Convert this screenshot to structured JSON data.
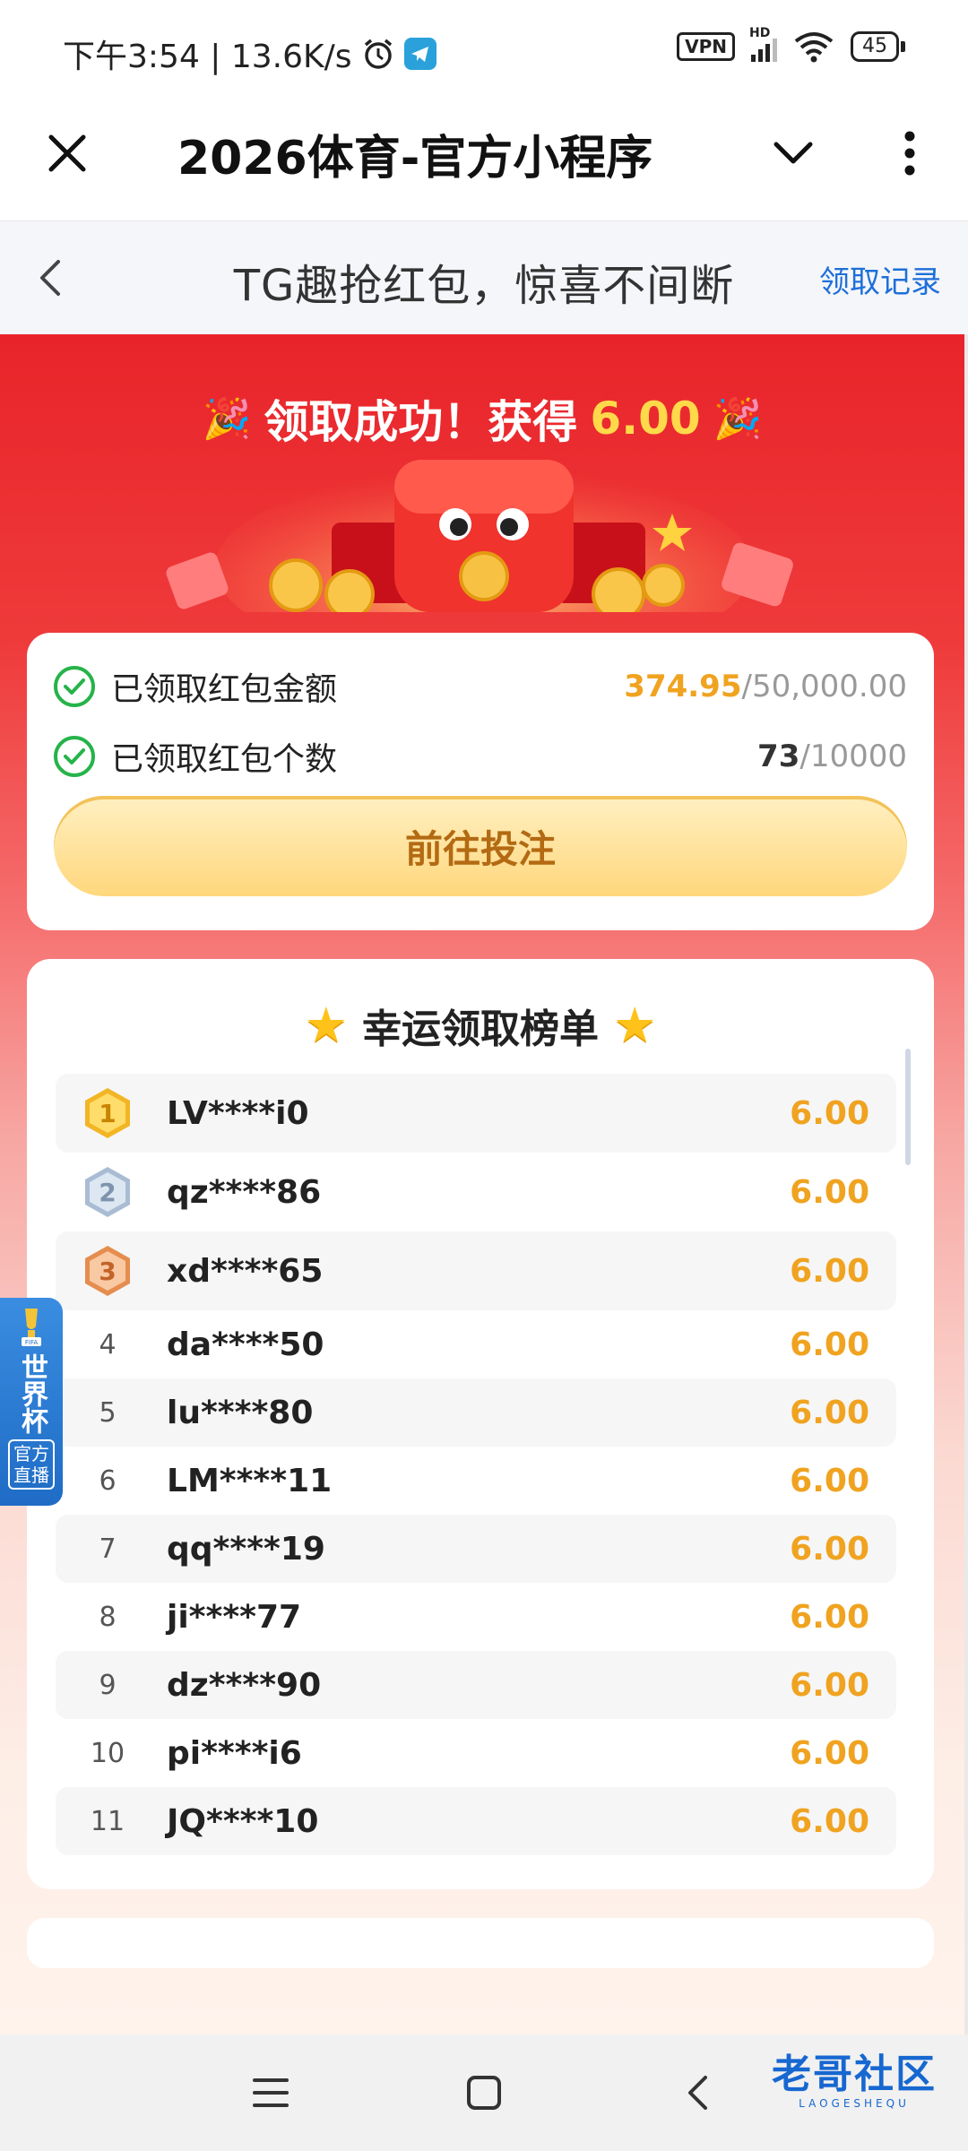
{
  "status_bar": {
    "time_speed": "下午3:54 | 13.6K/s",
    "vpn": "VPN",
    "hd": "HD",
    "battery": "45"
  },
  "app_header": {
    "title": "2026体育-官方小程序"
  },
  "sub_header": {
    "title": "TG趣抢红包，惊喜不间断",
    "record_link": "领取记录"
  },
  "banner": {
    "prefix": "领取成功！获得",
    "amount": "6.00"
  },
  "stats": {
    "amount_label": "已领取红包金额",
    "amount_current": "374.95",
    "amount_total": "/50,000.00",
    "count_label": "已领取红包个数",
    "count_current": "73",
    "count_total": "/10000",
    "button": "前往投注"
  },
  "leaderboard": {
    "title": "幸运领取榜单",
    "rows": [
      {
        "rank": "1",
        "name": "LV****i0",
        "amount": "6.00"
      },
      {
        "rank": "2",
        "name": "qz****86",
        "amount": "6.00"
      },
      {
        "rank": "3",
        "name": "xd****65",
        "amount": "6.00"
      },
      {
        "rank": "4",
        "name": "da****50",
        "amount": "6.00"
      },
      {
        "rank": "5",
        "name": "lu****80",
        "amount": "6.00"
      },
      {
        "rank": "6",
        "name": "LM****11",
        "amount": "6.00"
      },
      {
        "rank": "7",
        "name": "qq****19",
        "amount": "6.00"
      },
      {
        "rank": "8",
        "name": "ji****77",
        "amount": "6.00"
      },
      {
        "rank": "9",
        "name": "dz****90",
        "amount": "6.00"
      },
      {
        "rank": "10",
        "name": "pi****i6",
        "amount": "6.00"
      },
      {
        "rank": "11",
        "name": "JQ****10",
        "amount": "6.00"
      }
    ]
  },
  "worldcup_badge": {
    "fifa": "FIFA",
    "title": "世界杯",
    "sub": "官方直播"
  },
  "watermark": {
    "main": "老哥社区",
    "sub": "LAOGESHEQU"
  },
  "colors": {
    "brand_red": "#e8242a",
    "amount_orange": "#f0a320",
    "link_blue": "#1e6fd9",
    "check_green": "#26b34a"
  },
  "icons": [
    "close-icon",
    "chevron-down-icon",
    "more-vertical-icon",
    "back-arrow-icon",
    "check-circle-icon",
    "star-icon",
    "medal-icon",
    "party-popper-icon",
    "menu-icon",
    "home-square-icon",
    "nav-back-icon"
  ]
}
